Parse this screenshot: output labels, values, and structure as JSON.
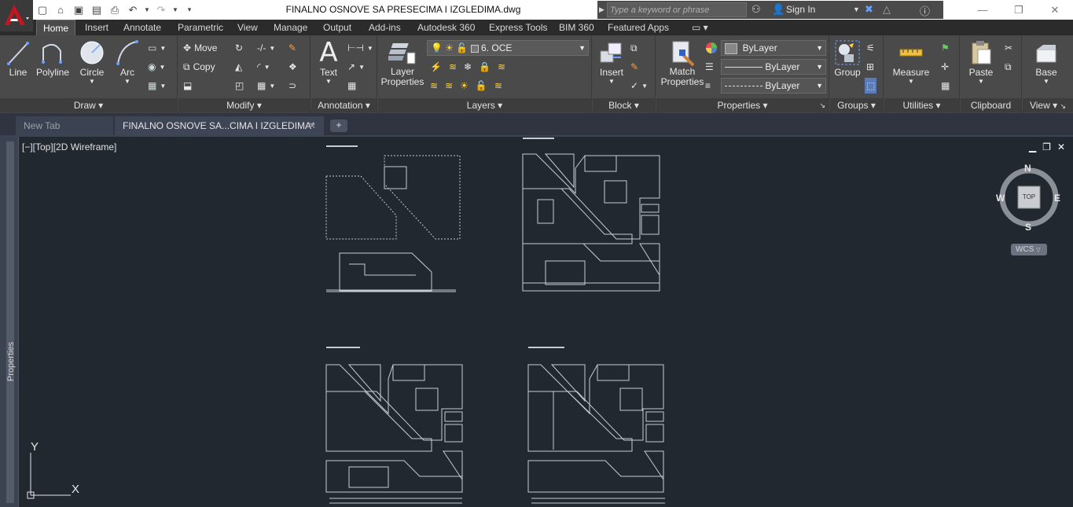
{
  "window": {
    "title": "FINALNO OSNOVE SA PRESECIMA I IZGLEDIMA.dwg",
    "search_placeholder": "Type a keyword or phrase",
    "sign_in": "Sign In"
  },
  "ribbon_tabs": [
    "Home",
    "Insert",
    "Annotate",
    "Parametric",
    "View",
    "Manage",
    "Output",
    "Add-ins",
    "Autodesk 360",
    "Express Tools",
    "BIM 360",
    "Featured Apps"
  ],
  "draw": {
    "title": "Draw",
    "line": "Line",
    "polyline": "Polyline",
    "circle": "Circle",
    "arc": "Arc"
  },
  "modify": {
    "title": "Modify",
    "move": "Move",
    "copy": "Copy"
  },
  "annotation": {
    "title": "Annotation",
    "text": "Text"
  },
  "layers": {
    "title": "Layers",
    "layer_properties_1": "Layer",
    "layer_properties_2": "Properties",
    "current_layer": "6. OCE"
  },
  "block": {
    "title": "Block",
    "insert": "Insert"
  },
  "properties": {
    "title": "Properties",
    "match_1": "Match",
    "match_2": "Properties",
    "color": "ByLayer",
    "linetype": "ByLayer",
    "lineweight": "ByLayer"
  },
  "groups": {
    "title": "Groups",
    "group": "Group"
  },
  "utilities": {
    "title": "Utilities",
    "measure": "Measure"
  },
  "clipboard": {
    "title": "Clipboard",
    "paste": "Paste"
  },
  "view": {
    "title": "View",
    "base": "Base"
  },
  "doc_tabs": {
    "new_tab": "New Tab",
    "file_tab": "FINALNO OSNOVE SA...CIMA I IZGLEDIMA*",
    "add": "+"
  },
  "viewport": {
    "label": "[−][Top][2D Wireframe]",
    "side_palette": "Properties",
    "ucs_x": "X",
    "ucs_y": "Y"
  },
  "viewcube": {
    "n": "N",
    "s": "S",
    "e": "E",
    "w": "W",
    "face": "TOP",
    "wcs": "WCS"
  }
}
